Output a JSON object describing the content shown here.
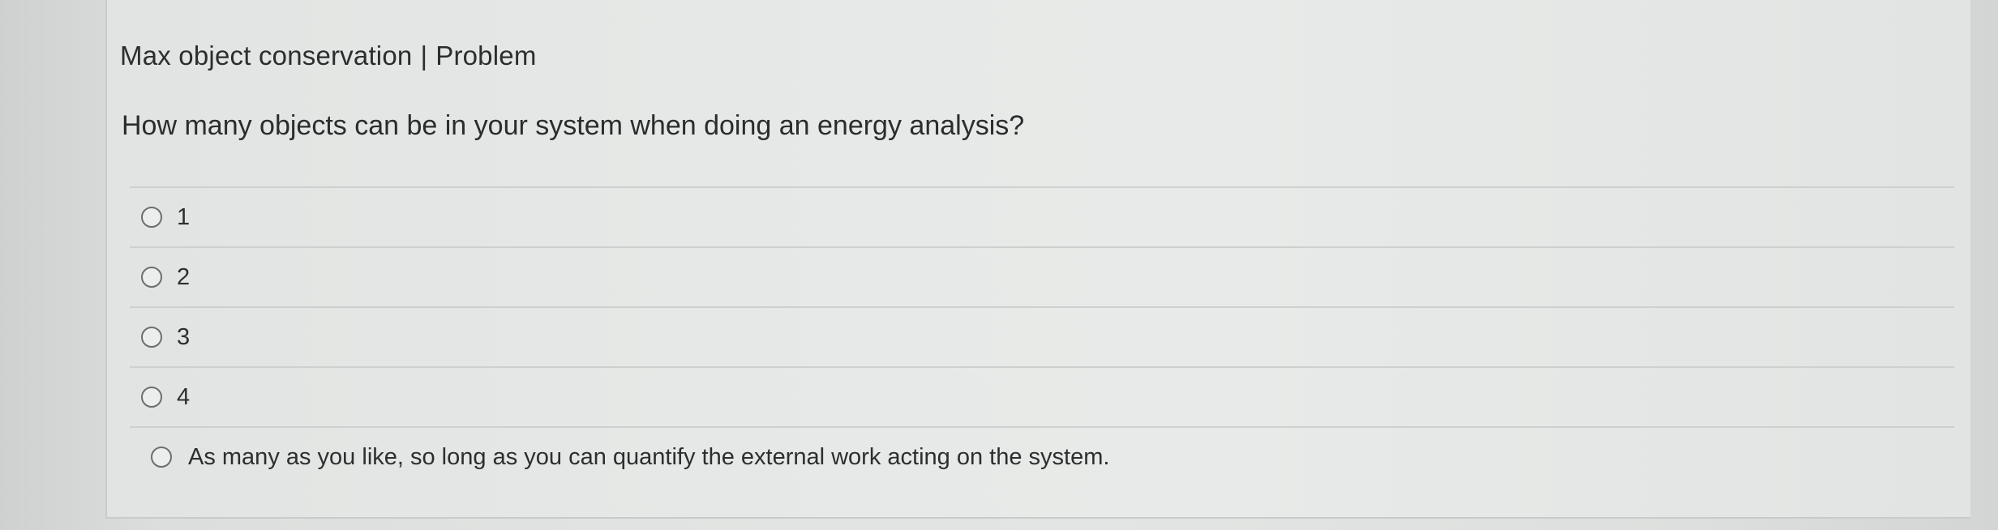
{
  "problem": {
    "title": "Max object conservation",
    "separator": "|",
    "type_label": "Problem",
    "question": "How many objects can be in your system when doing an energy analysis?",
    "options": [
      {
        "label": "1",
        "selected": false
      },
      {
        "label": "2",
        "selected": false
      },
      {
        "label": "3",
        "selected": false
      },
      {
        "label": "4",
        "selected": false
      },
      {
        "label": "As many as you like, so long as you can quantify the external work acting on the system.",
        "selected": false
      }
    ]
  }
}
